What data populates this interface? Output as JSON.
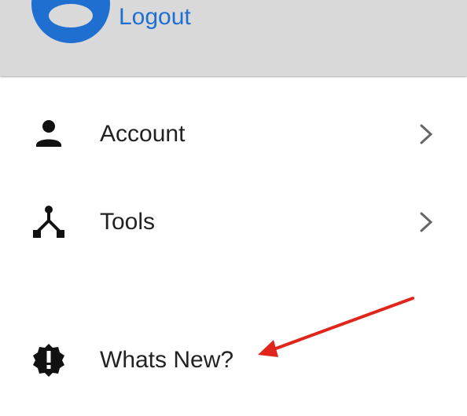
{
  "header": {
    "logout_label": "Logout",
    "accent_color": "#1f6fd0",
    "background_color": "#d9d9d9"
  },
  "menu": {
    "items": [
      {
        "label": "Account",
        "icon": "person-icon",
        "has_chevron": true
      },
      {
        "label": "Tools",
        "icon": "fork-icon",
        "has_chevron": true
      },
      {
        "label": "Whats New?",
        "icon": "alert-badge-icon",
        "has_chevron": false
      }
    ]
  },
  "annotation": {
    "arrow_color": "#e0261b",
    "points_to": "Whats New?"
  }
}
